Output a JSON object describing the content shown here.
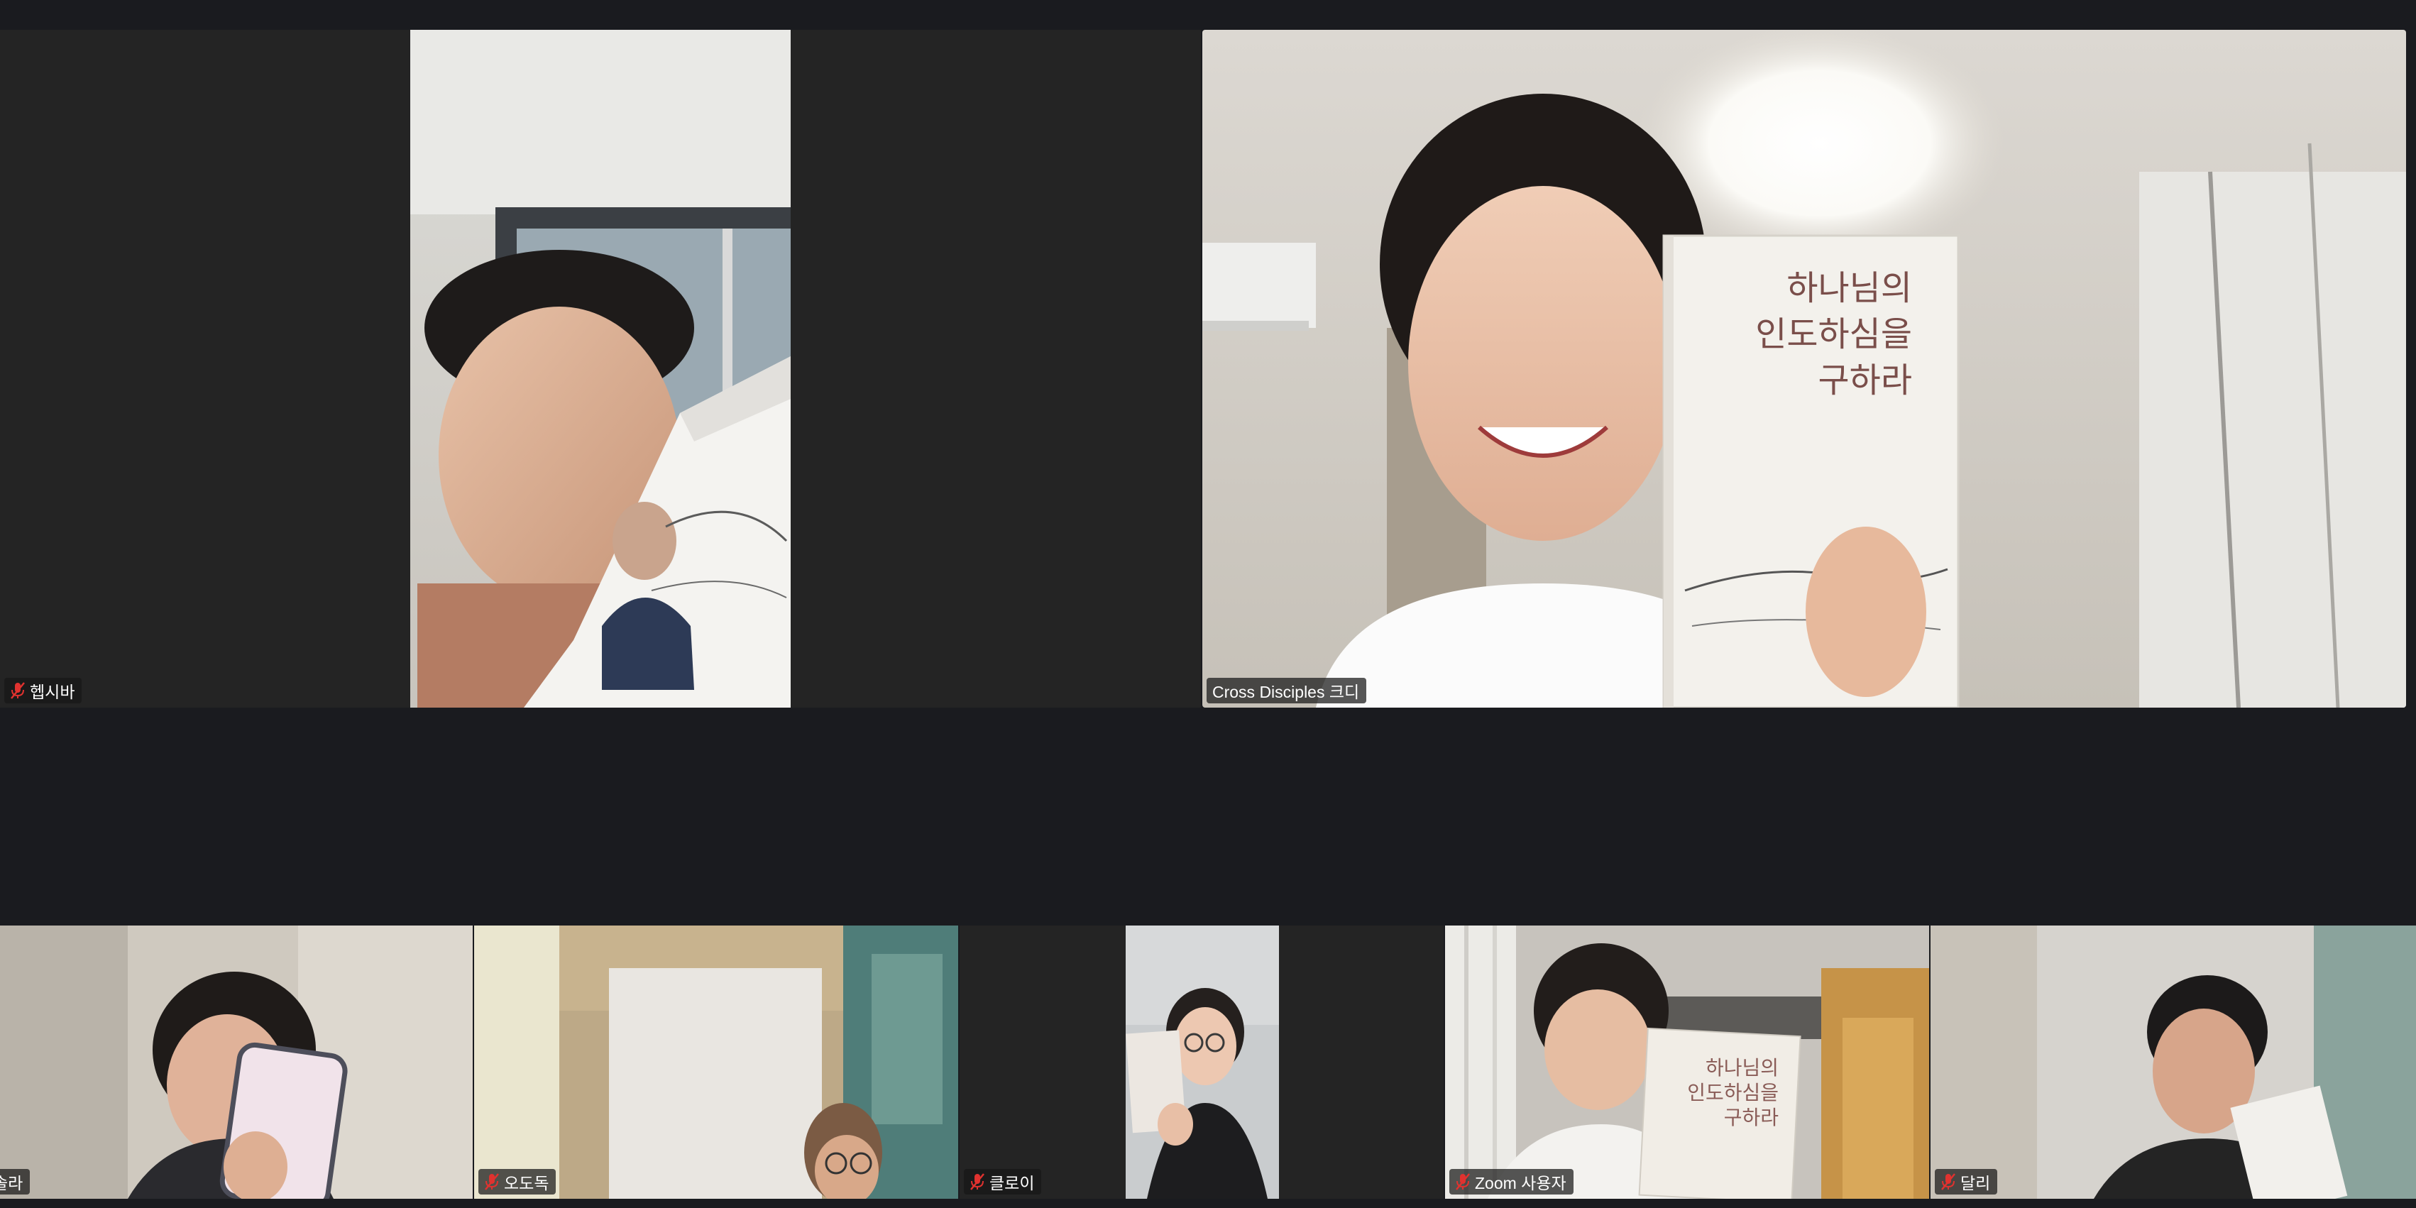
{
  "participants": [
    {
      "id": "p1",
      "name": "헵시바",
      "mic_muted": true
    },
    {
      "id": "p2",
      "name": "Cross Disciples 크디",
      "mic_muted": false
    },
    {
      "id": "p3",
      "name": "솔라",
      "mic_muted": false
    },
    {
      "id": "p4",
      "name": "오도독",
      "mic_muted": true
    },
    {
      "id": "p5",
      "name": "클로이",
      "mic_muted": true
    },
    {
      "id": "p6",
      "name": "Zoom 사용자",
      "mic_muted": true
    },
    {
      "id": "p7",
      "name": "달리",
      "mic_muted": true
    }
  ],
  "book": {
    "title_line1": "하나님의",
    "title_line2": "인도하심을",
    "title_line3": "구하라"
  },
  "colors": {
    "background": "#1a1b1f",
    "tile_bg": "#242424",
    "muted_icon": "#e0322f",
    "nameplate_bg": "rgba(22,22,22,0.72)"
  },
  "icons": {
    "muted": "mic-muted-icon"
  }
}
